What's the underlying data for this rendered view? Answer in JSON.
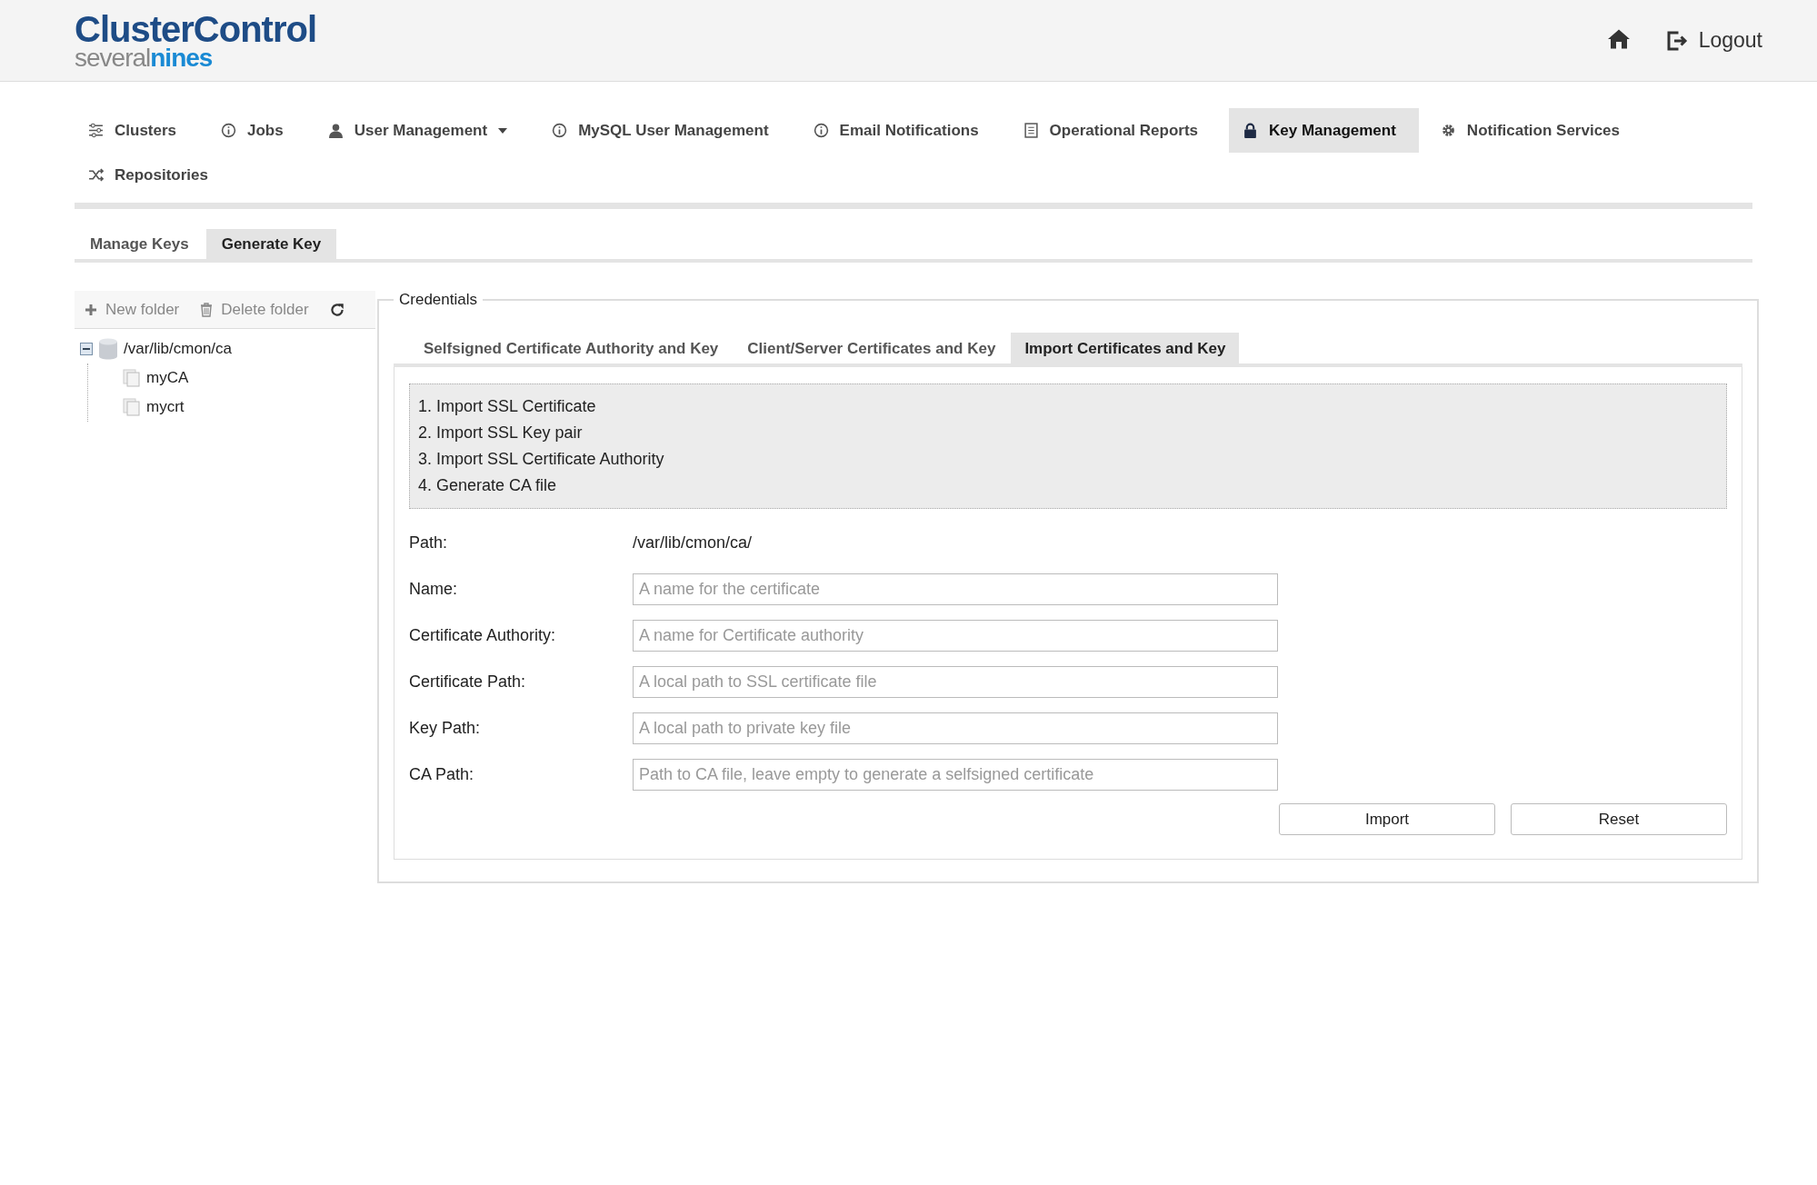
{
  "header": {
    "logo": {
      "title": "ClusterControl",
      "sub_a": "several",
      "sub_b": "nines"
    },
    "logout_link": {
      "label": "Logout"
    }
  },
  "nav": [
    {
      "label": "Clusters",
      "kind": "sliders",
      "selected": false,
      "dropdown": false
    },
    {
      "label": "Jobs",
      "kind": "info",
      "selected": false,
      "dropdown": false
    },
    {
      "label": "User Management",
      "kind": "user",
      "selected": false,
      "dropdown": true
    },
    {
      "label": "MySQL User Management",
      "kind": "info",
      "selected": false,
      "dropdown": false
    },
    {
      "label": "Email Notifications",
      "kind": "info",
      "selected": false,
      "dropdown": false
    },
    {
      "label": "Operational Reports",
      "kind": "doc",
      "selected": false,
      "dropdown": false
    },
    {
      "label": "Key Management",
      "kind": "lock",
      "selected": true,
      "dropdown": false
    },
    {
      "label": "Notification Services",
      "kind": "gear",
      "selected": false,
      "dropdown": false
    },
    {
      "label": "Repositories",
      "kind": "shuffle",
      "selected": false,
      "dropdown": false
    }
  ],
  "sub_tabs": [
    {
      "label": "Manage Keys",
      "selected": false
    },
    {
      "label": "Generate Key",
      "selected": true
    }
  ],
  "toolbar": [
    {
      "label": "New folder",
      "kind": "plus"
    },
    {
      "label": "Delete folder",
      "kind": "trash"
    }
  ],
  "tree": [
    {
      "label": "/var/lib/cmon/ca",
      "kind": "folder",
      "expanded": true,
      "children": [
        {
          "label": "myCA",
          "kind": "file"
        },
        {
          "label": "mycrt",
          "kind": "file"
        }
      ]
    }
  ],
  "credentials": {
    "legend": "Credentials",
    "tabs": [
      {
        "label": "Selfsigned Certificate Authority and Key",
        "selected": false
      },
      {
        "label": "Client/Server Certificates and Key",
        "selected": false
      },
      {
        "label": "Import Certificates and Key",
        "selected": true
      }
    ],
    "steps": [
      "1. Import SSL Certificate",
      "2. Import SSL Key pair",
      "3. Import SSL Certificate Authority",
      "4. Generate CA file"
    ],
    "fields": [
      {
        "label": "Path:",
        "kind": "value",
        "value": "/var/lib/cmon/ca/"
      },
      {
        "label": "Name:",
        "kind": "input",
        "placeholder": "A name for the certificate"
      },
      {
        "label": "Certificate Authority:",
        "kind": "input",
        "placeholder": "A name for Certificate authority"
      },
      {
        "label": "Certificate Path:",
        "kind": "input",
        "placeholder": "A local path to SSL certificate file"
      },
      {
        "label": "Key Path:",
        "kind": "input",
        "placeholder": "A local path to private key file"
      },
      {
        "label": "CA Path:",
        "kind": "input",
        "placeholder": "Path to CA file, leave empty to generate a selfsigned certificate"
      }
    ],
    "buttons": [
      "Import",
      "Reset"
    ]
  }
}
